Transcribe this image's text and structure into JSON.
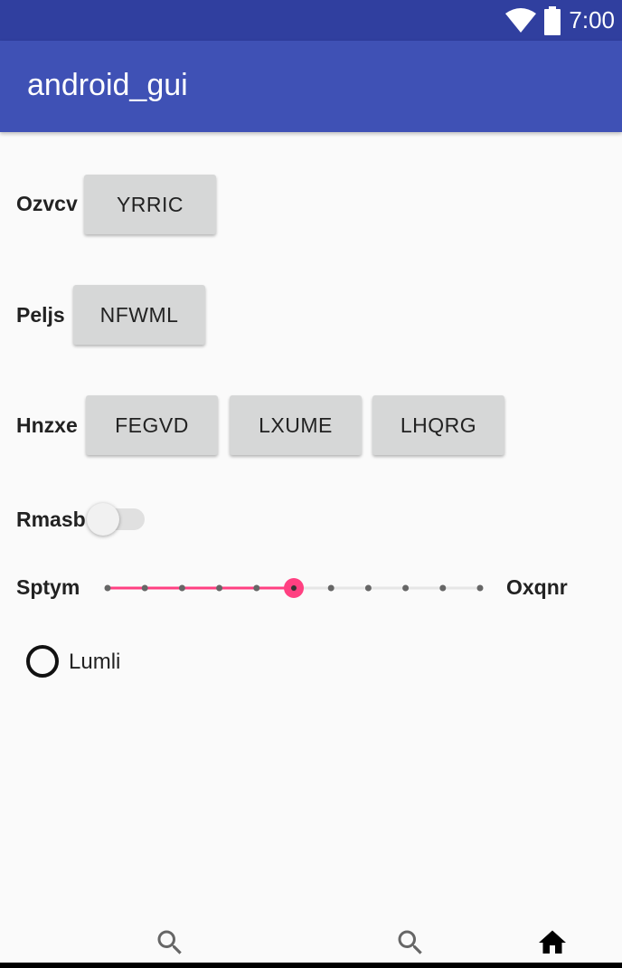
{
  "status_bar": {
    "time": "7:00",
    "icons": [
      "wifi-icon",
      "battery-icon"
    ]
  },
  "app_bar": {
    "title": "android_gui"
  },
  "rows": [
    {
      "label": "Ozvcv",
      "buttons": [
        "YRRIC"
      ]
    },
    {
      "label": "Peljs",
      "buttons": [
        "NFWML"
      ]
    },
    {
      "label": "Hnzxe",
      "buttons": [
        "FEGVD",
        "LXUME",
        "LHQRG"
      ]
    }
  ],
  "switch": {
    "label": "Rmasb",
    "checked": false
  },
  "seekbar": {
    "label_left": "Sptym",
    "label_right": "Oxqnr",
    "steps": 10,
    "value": 5
  },
  "radio": {
    "label": "Lumli",
    "checked": false
  },
  "bottom_nav": {
    "items": [
      "search-icon",
      "search-icon",
      "home-icon"
    ]
  },
  "colors": {
    "status_bar": "#303f9f",
    "app_bar": "#3f51b5",
    "accent": "#ff4081",
    "button": "#d6d7d7"
  }
}
